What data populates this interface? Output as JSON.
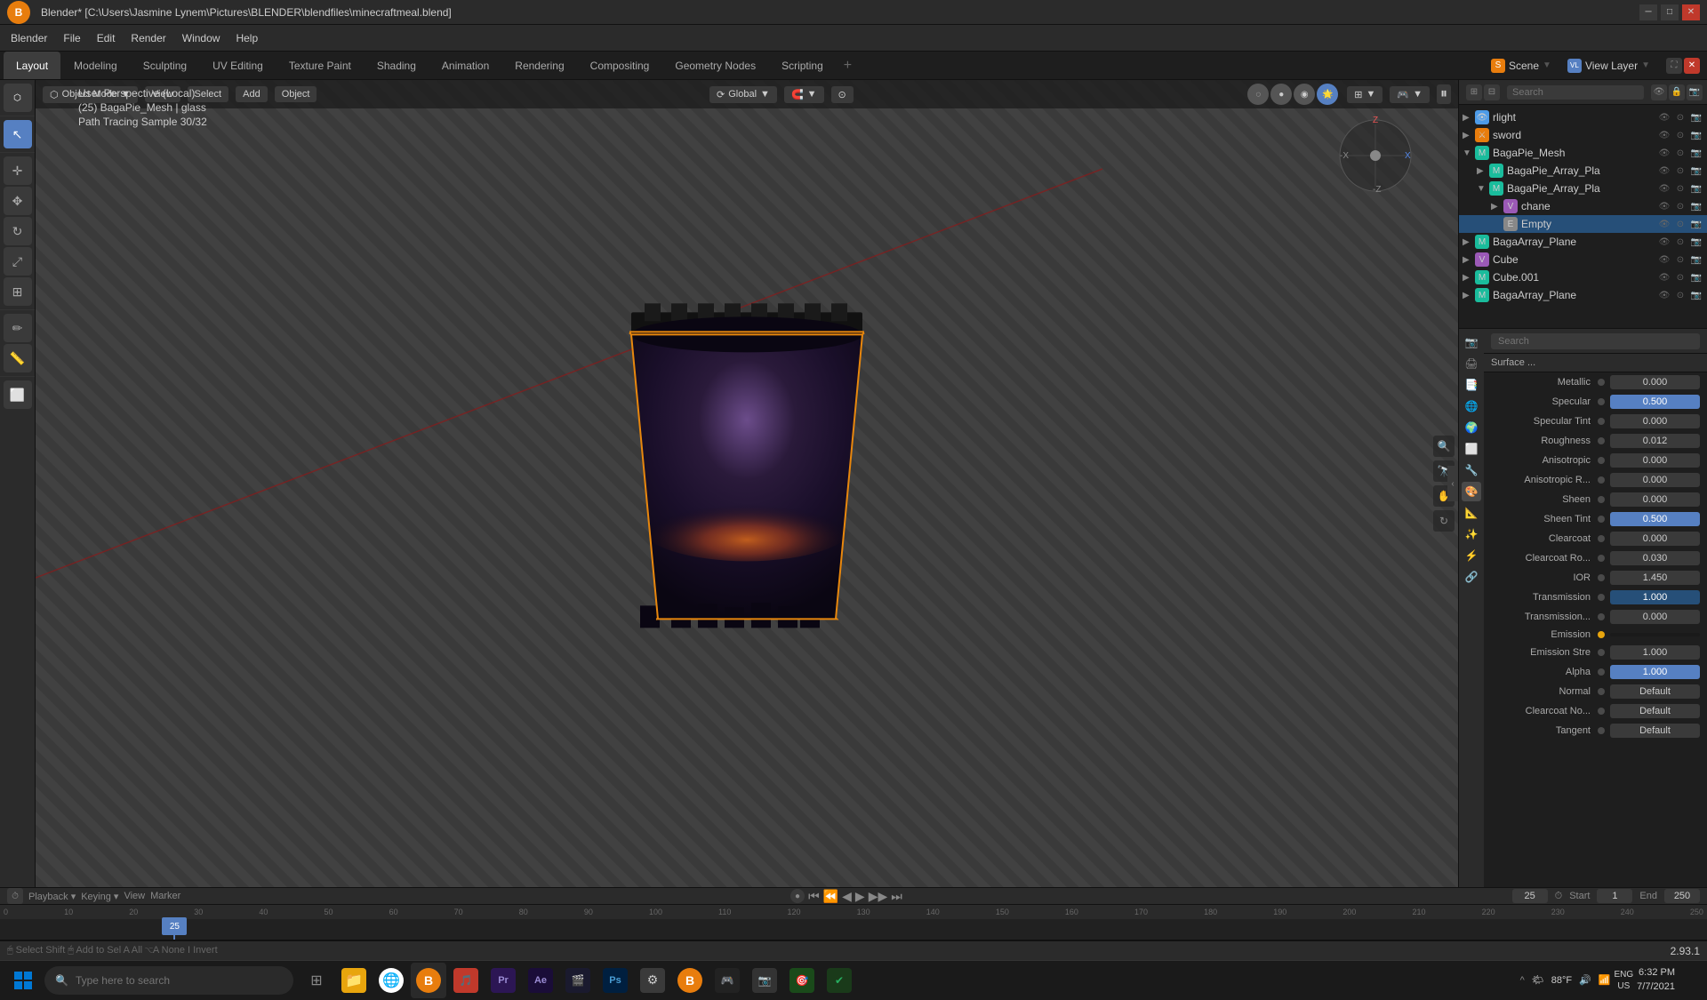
{
  "titlebar": {
    "title": "Blender* [C:\\Users\\Jasmine Lynem\\Pictures\\BLENDER\\blendfiles\\minecraftmeal.blend]",
    "min_label": "─",
    "max_label": "□",
    "close_label": "✕"
  },
  "menubar": {
    "logo": "B",
    "items": [
      "Blender",
      "File",
      "Edit",
      "Render",
      "Window",
      "Help"
    ]
  },
  "workspace_tabs": {
    "tabs": [
      "Layout",
      "Modeling",
      "Sculpting",
      "UV Editing",
      "Texture Paint",
      "Shading",
      "Animation",
      "Rendering",
      "Compositing",
      "Geometry Nodes",
      "Scripting"
    ],
    "active": "Layout",
    "add_label": "+",
    "scene_label": "Scene",
    "view_layer_label": "View Layer"
  },
  "viewport": {
    "mode_label": "Object Mode",
    "transform_label": "Global",
    "snap_label": "Snap",
    "overlay_label": "Overlay",
    "viewport_shading": "Rendered",
    "info_line1": "User Perspective (Local)",
    "info_line2": "(25) BagaPie_Mesh | glass",
    "info_line3": "Path Tracing Sample 30/32"
  },
  "outliner": {
    "search_placeholder": "Search",
    "items": [
      {
        "level": 0,
        "arrow": "▶",
        "icon": "👁",
        "icon_color": "blue",
        "label": "rlight",
        "has_vis": true
      },
      {
        "level": 0,
        "arrow": "▶",
        "icon": "⚔",
        "icon_color": "orange",
        "label": "sword",
        "has_vis": true
      },
      {
        "level": 0,
        "arrow": "▼",
        "icon": "M",
        "icon_color": "teal",
        "label": "BagaPie_Mesh",
        "has_vis": true
      },
      {
        "level": 1,
        "arrow": "▶",
        "icon": "M",
        "icon_color": "teal",
        "label": "BagaPie_Array_Pla",
        "has_vis": true
      },
      {
        "level": 1,
        "arrow": "▼",
        "icon": "M",
        "icon_color": "teal",
        "label": "BagaPie_Array_Pla",
        "has_vis": true
      },
      {
        "level": 2,
        "arrow": "▶",
        "icon": "V",
        "icon_color": "purple",
        "label": "chane",
        "has_vis": true
      },
      {
        "level": 2,
        "arrow": " ",
        "icon": "E",
        "icon_color": "gray",
        "label": "Empty",
        "has_vis": true,
        "selected": true
      },
      {
        "level": 0,
        "arrow": "▶",
        "icon": "M",
        "icon_color": "teal",
        "label": "BagaArray_Plane",
        "has_vis": true
      },
      {
        "level": 0,
        "arrow": "▶",
        "icon": "V",
        "icon_color": "purple",
        "label": "Cube",
        "has_vis": true
      },
      {
        "level": 0,
        "arrow": "▶",
        "icon": "M",
        "icon_color": "teal",
        "label": "Cube.001",
        "has_vis": true
      },
      {
        "level": 0,
        "arrow": "▶",
        "icon": "M",
        "icon_color": "teal",
        "label": "BagaArray_Plane",
        "has_vis": true
      }
    ]
  },
  "properties": {
    "search_placeholder": "Search",
    "rows": [
      {
        "label": "Metallic",
        "dot_active": false,
        "value": "0.000",
        "highlighted": false
      },
      {
        "label": "Specular",
        "dot_active": false,
        "value": "0.500",
        "highlighted": true
      },
      {
        "label": "Specular Tint",
        "dot_active": false,
        "value": "0.000",
        "highlighted": false
      },
      {
        "label": "Roughness",
        "dot_active": false,
        "value": "0.012",
        "highlighted": false
      },
      {
        "label": "Anisotropic",
        "dot_active": false,
        "value": "0.000",
        "highlighted": false
      },
      {
        "label": "Anisotropic R...",
        "dot_active": false,
        "value": "0.000",
        "highlighted": false
      },
      {
        "label": "Sheen",
        "dot_active": false,
        "value": "0.000",
        "highlighted": false
      },
      {
        "label": "Sheen Tint",
        "dot_active": false,
        "value": "0.500",
        "highlighted": true
      },
      {
        "label": "Clearcoat",
        "dot_active": false,
        "value": "0.000",
        "highlighted": false
      },
      {
        "label": "Clearcoat Ro...",
        "dot_active": false,
        "value": "0.030",
        "highlighted": false
      },
      {
        "label": "IOR",
        "dot_active": false,
        "value": "1.450",
        "highlighted": false
      },
      {
        "label": "Transmission",
        "dot_active": false,
        "value": "1.000",
        "highlighted": true,
        "blue": true
      },
      {
        "label": "Transmission...",
        "dot_active": false,
        "value": "0.000",
        "highlighted": false
      },
      {
        "label": "Emission",
        "dot_active": false,
        "value": "",
        "highlighted": false,
        "black": true,
        "dot_yellow": true
      },
      {
        "label": "Emission Stre",
        "dot_active": false,
        "value": "1.000",
        "highlighted": false
      },
      {
        "label": "Alpha",
        "dot_active": false,
        "value": "1.000",
        "highlighted": true,
        "active_blue": true
      },
      {
        "label": "Normal",
        "dot_active": false,
        "value": "Default",
        "highlighted": false
      },
      {
        "label": "Clearcoat No...",
        "dot_active": false,
        "value": "Default",
        "highlighted": false
      },
      {
        "label": "Tangent",
        "dot_active": false,
        "value": "Default",
        "highlighted": false
      }
    ],
    "side_icons": [
      "📷",
      "⚡",
      "🌐",
      "🎨",
      "⚙",
      "🔧",
      "🌟",
      "📐",
      "🔩"
    ]
  },
  "timeline": {
    "playback_label": "Playback",
    "keying_label": "Keying",
    "view_label": "View",
    "marker_label": "Marker",
    "frame_current": "25",
    "frame_start": "1",
    "frame_start_label": "Start",
    "frame_end": "250",
    "frame_end_label": "End",
    "ruler_marks": [
      "0",
      "10",
      "20",
      "25",
      "30",
      "40",
      "50",
      "60",
      "70",
      "80",
      "90",
      "100",
      "110",
      "120",
      "130",
      "140",
      "150",
      "160",
      "170",
      "180",
      "190",
      "200",
      "210",
      "220",
      "230",
      "240",
      "250"
    ]
  },
  "status_bar": {
    "left_label": "🖱",
    "right_label": "2.93.1"
  },
  "taskbar": {
    "search_placeholder": "Type here to search",
    "apps": [
      {
        "name": "File Explorer",
        "icon": "📁",
        "color": "#e8a50d"
      },
      {
        "name": "Chrome",
        "icon": "🌐",
        "color": "#4285f4"
      },
      {
        "name": "Blender",
        "icon": "B",
        "color": "#e87d0d"
      },
      {
        "name": "App4",
        "icon": "🎵",
        "color": "#ff4444"
      },
      {
        "name": "Premiere",
        "icon": "Pr",
        "color": "#9b59b6"
      },
      {
        "name": "App6",
        "icon": "Ae",
        "color": "#9b59b6"
      },
      {
        "name": "App7",
        "icon": "🎬",
        "color": "#333"
      },
      {
        "name": "Photoshop",
        "icon": "Ps",
        "color": "#1a6896"
      },
      {
        "name": "Settings",
        "icon": "⚙",
        "color": "#666"
      },
      {
        "name": "Blender2",
        "icon": "B",
        "color": "#e87d0d"
      },
      {
        "name": "App11",
        "icon": "🎮",
        "color": "#444"
      },
      {
        "name": "App12",
        "icon": "📷",
        "color": "#555"
      },
      {
        "name": "App13",
        "icon": "🎯",
        "color": "#27ae60"
      },
      {
        "name": "App14",
        "icon": "✔",
        "color": "#27ae60"
      }
    ],
    "sys_tray": {
      "weather_icon": "🌤",
      "temp": "88°F",
      "volume_icon": "🔊",
      "network_icon": "📶",
      "lang": "ENG\nUS",
      "time": "6:32 PM",
      "date": "7/7/2021"
    }
  }
}
